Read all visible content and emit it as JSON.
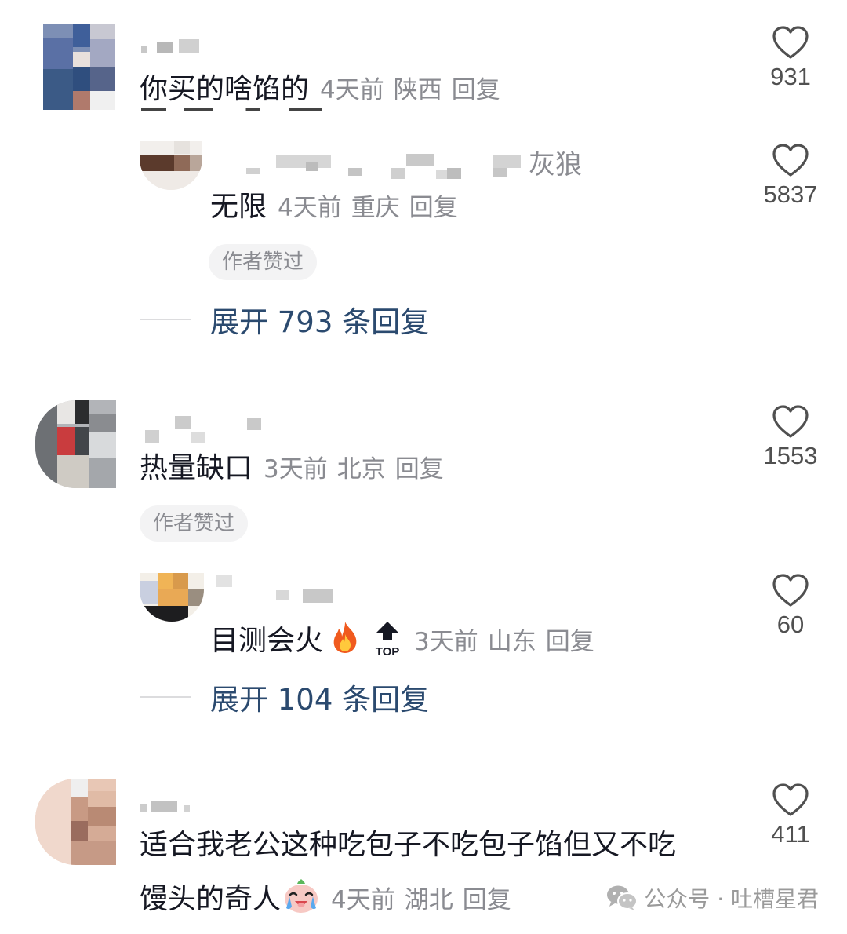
{
  "comments": [
    {
      "text": "你买的啥馅的",
      "time": "4天前",
      "location": "陕西",
      "reply_label": "回复",
      "likes": "931"
    },
    {
      "name_fragment": "灰狼",
      "text": "无限",
      "time": "4天前",
      "location": "重庆",
      "reply_label": "回复",
      "likes": "5837",
      "author_liked": "作者赞过",
      "expand_label": "展开 793 条回复"
    },
    {
      "text": "热量缺口",
      "time": "3天前",
      "location": "北京",
      "reply_label": "回复",
      "likes": "1553",
      "author_liked": "作者赞过"
    },
    {
      "text": "目测会火",
      "emoji": "fire-emoji",
      "top_badge": "TOP",
      "time": "3天前",
      "location": "山东",
      "reply_label": "回复",
      "likes": "60",
      "expand_label": "展开 104 条回复"
    },
    {
      "text_line1": "适合我老公这种吃包子不吃包子馅但又不吃",
      "text_line2": "馒头的奇人",
      "emoji": "crying-emoji",
      "time": "4天前",
      "location": "湖北",
      "reply_label": "回复",
      "likes": "411"
    }
  ],
  "watermark": {
    "icon": "wechat-icon",
    "text": "公众号 · 吐槽星君"
  },
  "colors": {
    "text": "#161823",
    "meta": "#8a8b91",
    "link": "#2b4a6f",
    "heart": "#505050"
  }
}
